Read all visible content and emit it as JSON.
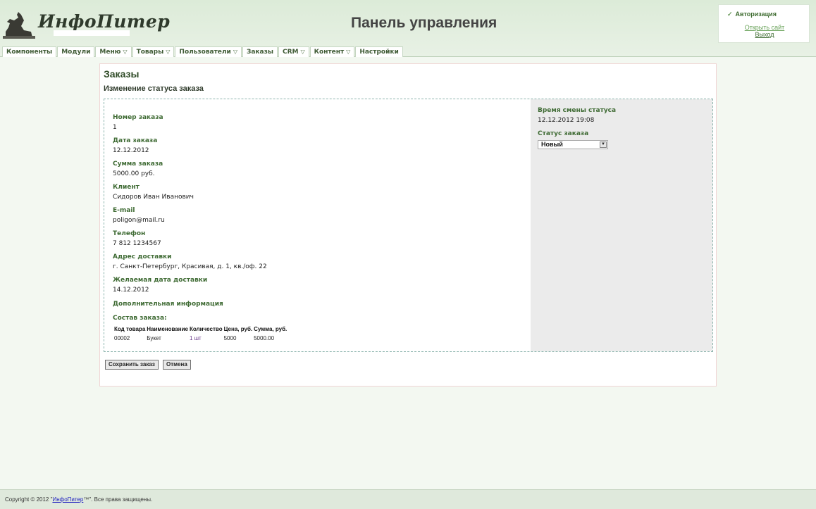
{
  "header": {
    "logo_text": "ИнфоПитер",
    "title": "Панель управления"
  },
  "auth": {
    "title": "Авторизация",
    "open_site": "Открыть сайт",
    "logout": "Выход"
  },
  "menu": [
    {
      "label": "Компоненты",
      "dropdown": false
    },
    {
      "label": "Модули",
      "dropdown": false
    },
    {
      "label": "Меню",
      "dropdown": true
    },
    {
      "label": "Товары",
      "dropdown": true
    },
    {
      "label": "Пользователи",
      "dropdown": true
    },
    {
      "label": "Заказы",
      "dropdown": false
    },
    {
      "label": "CRM",
      "dropdown": true
    },
    {
      "label": "Контент",
      "dropdown": true
    },
    {
      "label": "Настройки",
      "dropdown": false
    }
  ],
  "page": {
    "title": "Заказы",
    "subtitle": "Изменение статуса заказа"
  },
  "order": {
    "number_label": "Номер заказа",
    "number": "1",
    "date_label": "Дата заказа",
    "date": "12.12.2012",
    "sum_label": "Сумма заказа",
    "sum": "5000.00 руб.",
    "client_label": "Клиент",
    "client": "Сидоров Иван Иванович",
    "email_label": "E-mail",
    "email": "poligon@mail.ru",
    "phone_label": "Телефон",
    "phone": "7 812 1234567",
    "address_label": "Адрес доставки",
    "address": "г. Санкт-Петербург, Красивая, д. 1, кв./оф. 22",
    "desired_date_label": "Желаемая дата доставки",
    "desired_date": "14.12.2012",
    "extra_label": "Дополнительная информация",
    "composition_label": "Состав заказа:"
  },
  "status": {
    "time_label": "Время смены статуса",
    "time": "12.12.2012 19:08",
    "status_label": "Статус заказа",
    "selected": "Новый"
  },
  "items": {
    "headers": [
      "Код товара",
      "Наименование",
      "Количество",
      "Цена, руб.",
      "Сумма, руб."
    ],
    "rows": [
      [
        "00002",
        "Букет",
        "1 шт",
        "5000",
        "5000.00"
      ]
    ]
  },
  "buttons": {
    "save": "Сохранить заказ",
    "cancel": "Отмена"
  },
  "footer": {
    "prefix": "Copyright © 2012 \"",
    "link": "ИнфоПитер",
    "suffix": "™\". Все права защищены."
  }
}
